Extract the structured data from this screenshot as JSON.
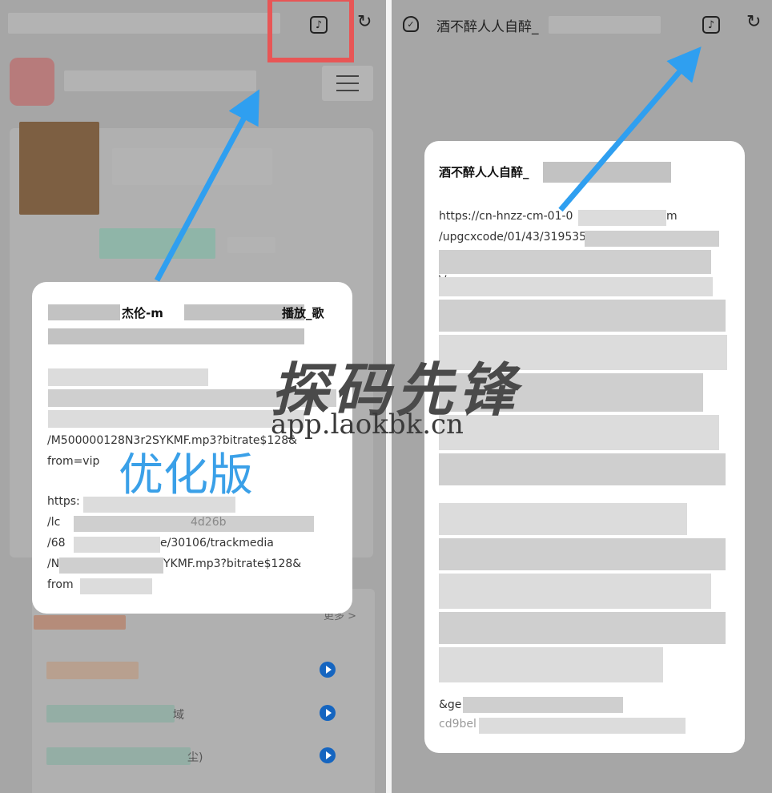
{
  "left": {
    "header_icon": "music-note-icon",
    "refresh_icon": "refresh-icon",
    "menu_icon": "hamburger-menu-icon",
    "dialog": {
      "title_fragment": "杰伦-m",
      "title_suffix": "播放_歌",
      "line1": "/M500000128N3r2SYKMF.mp3?bitrate$128&",
      "line2": "from=vip",
      "link2_start": "https:",
      "frag1": "/lc",
      "frag2": "/68",
      "frag3": "e/30106/trackmedia",
      "frag4": "/N",
      "frag5": "YKMF.mp3?bitrate$128&",
      "frag6": "from",
      "frag7": "4d26b"
    },
    "more_label": "更多 >",
    "list_suffix1": "域",
    "list_suffix2": "尘)",
    "play_icon": "play-circle-icon"
  },
  "right": {
    "shield_icon": "shield-check-icon",
    "title": "酒不醉人人自醉_",
    "header_icon": "music-note-icon",
    "refresh_icon": "refresh-icon",
    "dialog": {
      "title": "酒不醉人人自醉_",
      "url_line1": "https://cn-hnzz-cm-01-0",
      "url_line1_end": "m",
      "url_line2": "/upgcxcode/01/43/319535",
      "url_line3_start": "\\/",
      "gen_line": "&ge",
      "last_line": "cd9bel"
    }
  },
  "overlay": {
    "watermark_cn": "探码先锋",
    "watermark_url": "app.laokbk.cn",
    "badge": "优化版"
  },
  "colors": {
    "arrow": "#2f9ff0",
    "highlight_box": "#e85656",
    "play": "#1565c0",
    "badge": "#3aa0e8"
  }
}
